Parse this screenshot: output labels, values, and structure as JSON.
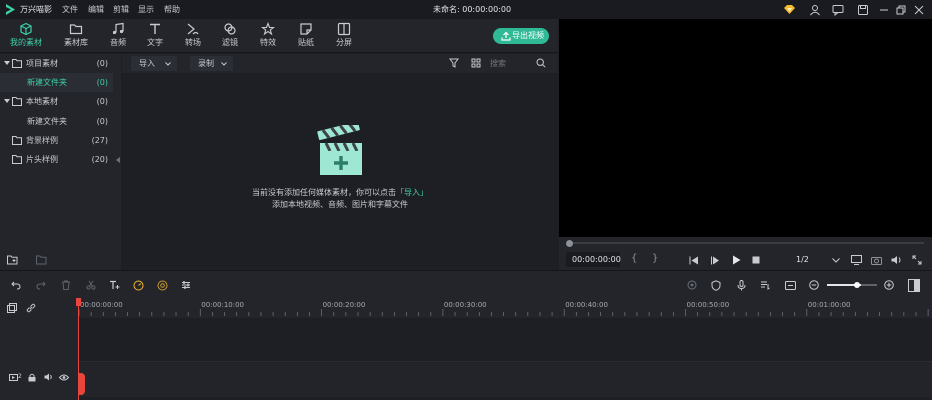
{
  "app": {
    "name": "万兴喵影",
    "project_title": "未命名: 00:00:00:00"
  },
  "menu": [
    "文件",
    "编辑",
    "剪辑",
    "显示",
    "帮助"
  ],
  "modules": [
    {
      "label": "我的素材",
      "icon": "folder-box-icon",
      "active": true
    },
    {
      "label": "素材库",
      "icon": "folder-icon"
    },
    {
      "label": "音频",
      "icon": "music-note-icon"
    },
    {
      "label": "文字",
      "icon": "text-icon"
    },
    {
      "label": "转场",
      "icon": "transition-icon"
    },
    {
      "label": "滤镜",
      "icon": "filter-icon"
    },
    {
      "label": "特效",
      "icon": "effects-icon"
    },
    {
      "label": "贴纸",
      "icon": "sticker-icon"
    },
    {
      "label": "分屏",
      "icon": "split-screen-icon"
    }
  ],
  "export_label": "导出视频",
  "folders": [
    {
      "name": "项目素材",
      "count": "(0)"
    },
    {
      "name": "新建文件夹",
      "count": "(0)",
      "selected": true
    },
    {
      "name": "本地素材",
      "count": "(0)"
    },
    {
      "name": "新建文件夹",
      "count": "(0)"
    },
    {
      "name": "背景样例",
      "count": "(27)"
    },
    {
      "name": "片头样例",
      "count": "(20)"
    }
  ],
  "media_toolbar": {
    "import_label": "导入",
    "record_label": "录制",
    "search_placeholder": "搜索"
  },
  "empty_state": {
    "line1_pre": "当前没有添加任何媒体素材，你可以点击",
    "line1_link": "「导入」",
    "line2": "添加本地视频、音频、图片和字幕文件"
  },
  "preview": {
    "timecode": "00:00:00:00",
    "quality": "1/2",
    "progress": 0
  },
  "timeline": {
    "ruler_labels": [
      "00:00:00:00",
      "00:00:10:00",
      "00:00:20:00",
      "00:00:30:00",
      "00:00:40:00",
      "00:00:50:00",
      "00:01:00:00"
    ],
    "track_number": "2",
    "zoom_level": 0.68
  },
  "colors": {
    "accent": "#2fb995",
    "accent_text": "#3fd0a8",
    "playhead": "#e8453c"
  }
}
